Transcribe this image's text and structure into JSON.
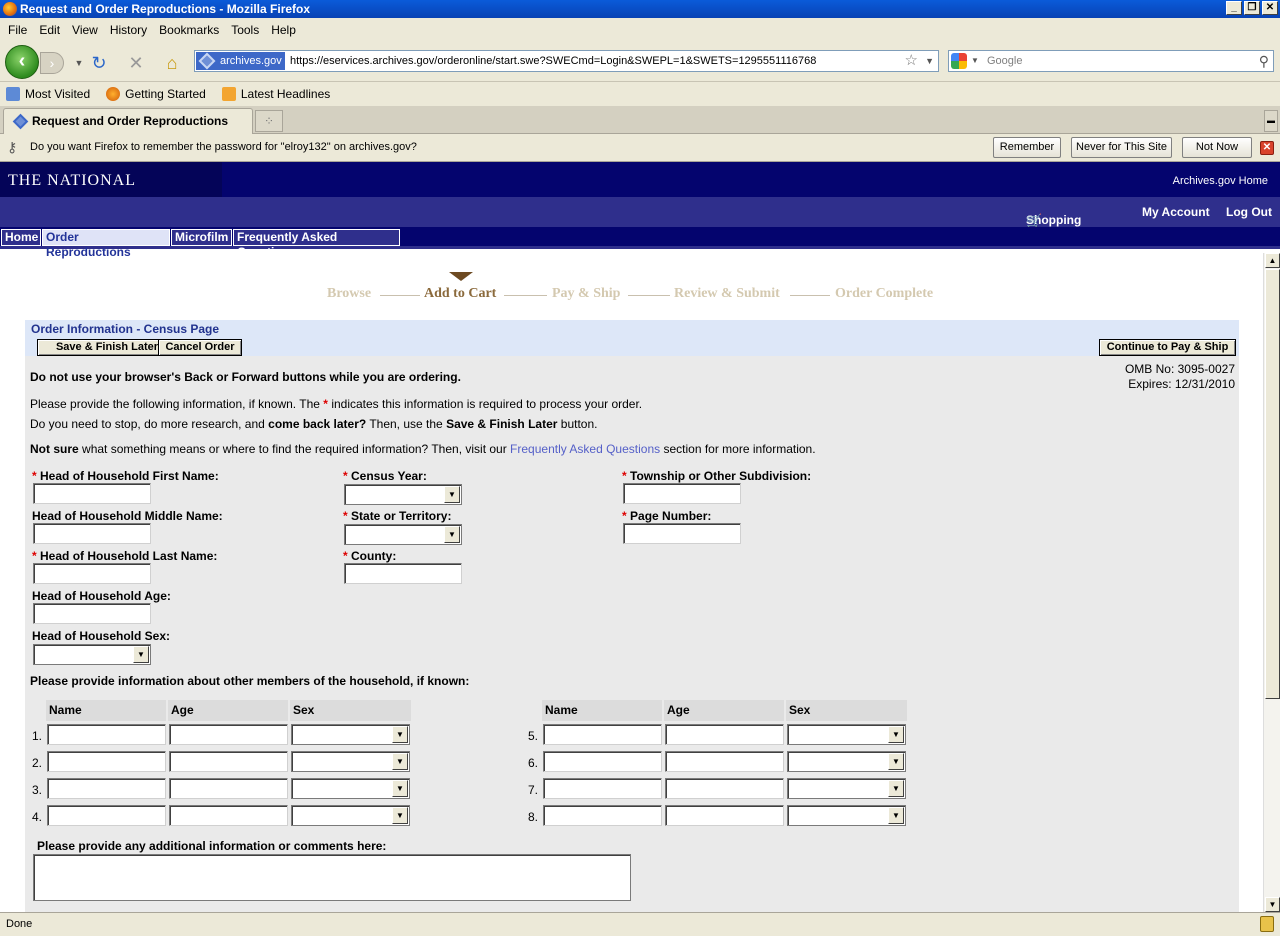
{
  "browser": {
    "window_title": "Request and Order Reproductions - Mozilla Firefox",
    "menu": [
      "File",
      "Edit",
      "View",
      "History",
      "Bookmarks",
      "Tools",
      "Help"
    ],
    "url_badge": "archives.gov",
    "url": "https://eservices.archives.gov/orderonline/start.swe?SWECmd=Login&SWEPL=1&SWETS=1295551116768",
    "search_placeholder": "Google",
    "bookmarks": [
      "Most Visited",
      "Getting Started",
      "Latest Headlines"
    ],
    "tab_title": "Request and Order Reproductions",
    "password_prompt": "Do you want Firefox to remember the password for \"elroy132\" on archives.gov?",
    "password_buttons": {
      "remember": "Remember",
      "never": "Never for This Site",
      "not_now": "Not Now"
    },
    "status": "Done"
  },
  "site": {
    "logo": "THE NATIONAL ARCHIVES",
    "home_link": "Archives.gov Home",
    "top_links": {
      "cart": "Shopping Cart",
      "account": "My Account",
      "logout": "Log Out"
    },
    "nav_tabs": [
      "Home",
      "Order Reproductions",
      "Microfilm",
      "Frequently Asked Questions"
    ]
  },
  "progress": {
    "steps": [
      "Browse",
      "Add to Cart",
      "Pay & Ship",
      "Review & Submit",
      "Order Complete"
    ],
    "current": "Add to Cart"
  },
  "panel": {
    "title": "Order Information - Census Page",
    "buttons": {
      "save": "Save & Finish Later",
      "cancel": "Cancel Order",
      "continue": "Continue to Pay & Ship"
    },
    "omb": "OMB No: 3095-0027",
    "expires": "Expires: 12/31/2010",
    "warning": "Do not use your browser's Back or Forward buttons while you are ordering.",
    "info1_a": "Please provide the following information, if known. The",
    "info1_star": "*",
    "info1_b": "indicates this information is required to process your order.",
    "info2_a": "Do you need to stop, do more research, and",
    "info2_b": "come back later?",
    "info2_c": "Then, use the",
    "info2_d": "Save & Finish Later",
    "info2_e": "button.",
    "info3_a": "Not sure",
    "info3_b": "what something means or where to find the required information? Then, visit our",
    "info3_link": "Frequently Asked Questions",
    "info3_c": "section for more information."
  },
  "fields": {
    "first_name": "Head of Household First Name:",
    "middle_name": "Head of Household Middle Name:",
    "last_name": "Head of Household Last Name:",
    "age": "Head of Household Age:",
    "sex": "Head of Household Sex:",
    "census_year": "Census Year:",
    "state": "State or Territory:",
    "county": "County:",
    "township": "Township or Other Subdivision:",
    "page_number": "Page Number:",
    "required_marker": "*"
  },
  "members": {
    "heading": "Please provide information about other members of the household, if known:",
    "columns": [
      "Name",
      "Age",
      "Sex"
    ],
    "rows_left": [
      "1.",
      "2.",
      "3.",
      "4."
    ],
    "rows_right": [
      "5.",
      "6.",
      "7.",
      "8."
    ]
  },
  "comments_label": "Please provide any additional information or comments here:"
}
